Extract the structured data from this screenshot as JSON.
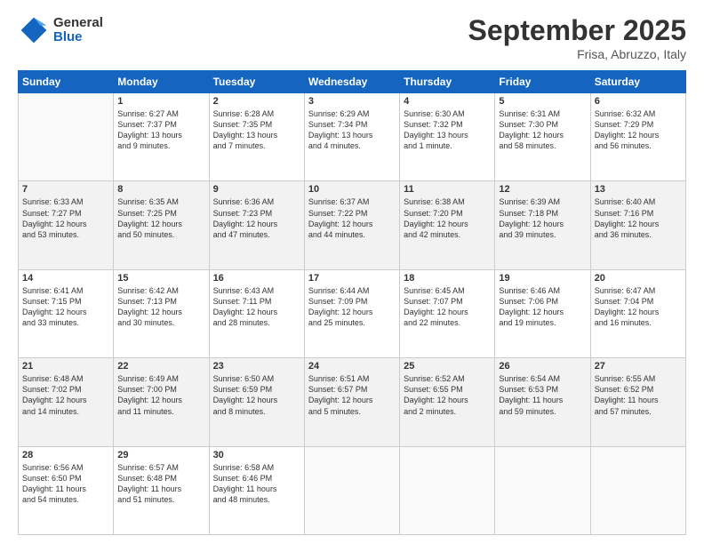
{
  "logo": {
    "general": "General",
    "blue": "Blue"
  },
  "header": {
    "month": "September 2025",
    "location": "Frisa, Abruzzo, Italy"
  },
  "weekdays": [
    "Sunday",
    "Monday",
    "Tuesday",
    "Wednesday",
    "Thursday",
    "Friday",
    "Saturday"
  ],
  "weeks": [
    [
      {
        "day": "",
        "text": ""
      },
      {
        "day": "1",
        "text": "Sunrise: 6:27 AM\nSunset: 7:37 PM\nDaylight: 13 hours\nand 9 minutes."
      },
      {
        "day": "2",
        "text": "Sunrise: 6:28 AM\nSunset: 7:35 PM\nDaylight: 13 hours\nand 7 minutes."
      },
      {
        "day": "3",
        "text": "Sunrise: 6:29 AM\nSunset: 7:34 PM\nDaylight: 13 hours\nand 4 minutes."
      },
      {
        "day": "4",
        "text": "Sunrise: 6:30 AM\nSunset: 7:32 PM\nDaylight: 13 hours\nand 1 minute."
      },
      {
        "day": "5",
        "text": "Sunrise: 6:31 AM\nSunset: 7:30 PM\nDaylight: 12 hours\nand 58 minutes."
      },
      {
        "day": "6",
        "text": "Sunrise: 6:32 AM\nSunset: 7:29 PM\nDaylight: 12 hours\nand 56 minutes."
      }
    ],
    [
      {
        "day": "7",
        "text": "Sunrise: 6:33 AM\nSunset: 7:27 PM\nDaylight: 12 hours\nand 53 minutes."
      },
      {
        "day": "8",
        "text": "Sunrise: 6:35 AM\nSunset: 7:25 PM\nDaylight: 12 hours\nand 50 minutes."
      },
      {
        "day": "9",
        "text": "Sunrise: 6:36 AM\nSunset: 7:23 PM\nDaylight: 12 hours\nand 47 minutes."
      },
      {
        "day": "10",
        "text": "Sunrise: 6:37 AM\nSunset: 7:22 PM\nDaylight: 12 hours\nand 44 minutes."
      },
      {
        "day": "11",
        "text": "Sunrise: 6:38 AM\nSunset: 7:20 PM\nDaylight: 12 hours\nand 42 minutes."
      },
      {
        "day": "12",
        "text": "Sunrise: 6:39 AM\nSunset: 7:18 PM\nDaylight: 12 hours\nand 39 minutes."
      },
      {
        "day": "13",
        "text": "Sunrise: 6:40 AM\nSunset: 7:16 PM\nDaylight: 12 hours\nand 36 minutes."
      }
    ],
    [
      {
        "day": "14",
        "text": "Sunrise: 6:41 AM\nSunset: 7:15 PM\nDaylight: 12 hours\nand 33 minutes."
      },
      {
        "day": "15",
        "text": "Sunrise: 6:42 AM\nSunset: 7:13 PM\nDaylight: 12 hours\nand 30 minutes."
      },
      {
        "day": "16",
        "text": "Sunrise: 6:43 AM\nSunset: 7:11 PM\nDaylight: 12 hours\nand 28 minutes."
      },
      {
        "day": "17",
        "text": "Sunrise: 6:44 AM\nSunset: 7:09 PM\nDaylight: 12 hours\nand 25 minutes."
      },
      {
        "day": "18",
        "text": "Sunrise: 6:45 AM\nSunset: 7:07 PM\nDaylight: 12 hours\nand 22 minutes."
      },
      {
        "day": "19",
        "text": "Sunrise: 6:46 AM\nSunset: 7:06 PM\nDaylight: 12 hours\nand 19 minutes."
      },
      {
        "day": "20",
        "text": "Sunrise: 6:47 AM\nSunset: 7:04 PM\nDaylight: 12 hours\nand 16 minutes."
      }
    ],
    [
      {
        "day": "21",
        "text": "Sunrise: 6:48 AM\nSunset: 7:02 PM\nDaylight: 12 hours\nand 14 minutes."
      },
      {
        "day": "22",
        "text": "Sunrise: 6:49 AM\nSunset: 7:00 PM\nDaylight: 12 hours\nand 11 minutes."
      },
      {
        "day": "23",
        "text": "Sunrise: 6:50 AM\nSunset: 6:59 PM\nDaylight: 12 hours\nand 8 minutes."
      },
      {
        "day": "24",
        "text": "Sunrise: 6:51 AM\nSunset: 6:57 PM\nDaylight: 12 hours\nand 5 minutes."
      },
      {
        "day": "25",
        "text": "Sunrise: 6:52 AM\nSunset: 6:55 PM\nDaylight: 12 hours\nand 2 minutes."
      },
      {
        "day": "26",
        "text": "Sunrise: 6:54 AM\nSunset: 6:53 PM\nDaylight: 11 hours\nand 59 minutes."
      },
      {
        "day": "27",
        "text": "Sunrise: 6:55 AM\nSunset: 6:52 PM\nDaylight: 11 hours\nand 57 minutes."
      }
    ],
    [
      {
        "day": "28",
        "text": "Sunrise: 6:56 AM\nSunset: 6:50 PM\nDaylight: 11 hours\nand 54 minutes."
      },
      {
        "day": "29",
        "text": "Sunrise: 6:57 AM\nSunset: 6:48 PM\nDaylight: 11 hours\nand 51 minutes."
      },
      {
        "day": "30",
        "text": "Sunrise: 6:58 AM\nSunset: 6:46 PM\nDaylight: 11 hours\nand 48 minutes."
      },
      {
        "day": "",
        "text": ""
      },
      {
        "day": "",
        "text": ""
      },
      {
        "day": "",
        "text": ""
      },
      {
        "day": "",
        "text": ""
      }
    ]
  ]
}
